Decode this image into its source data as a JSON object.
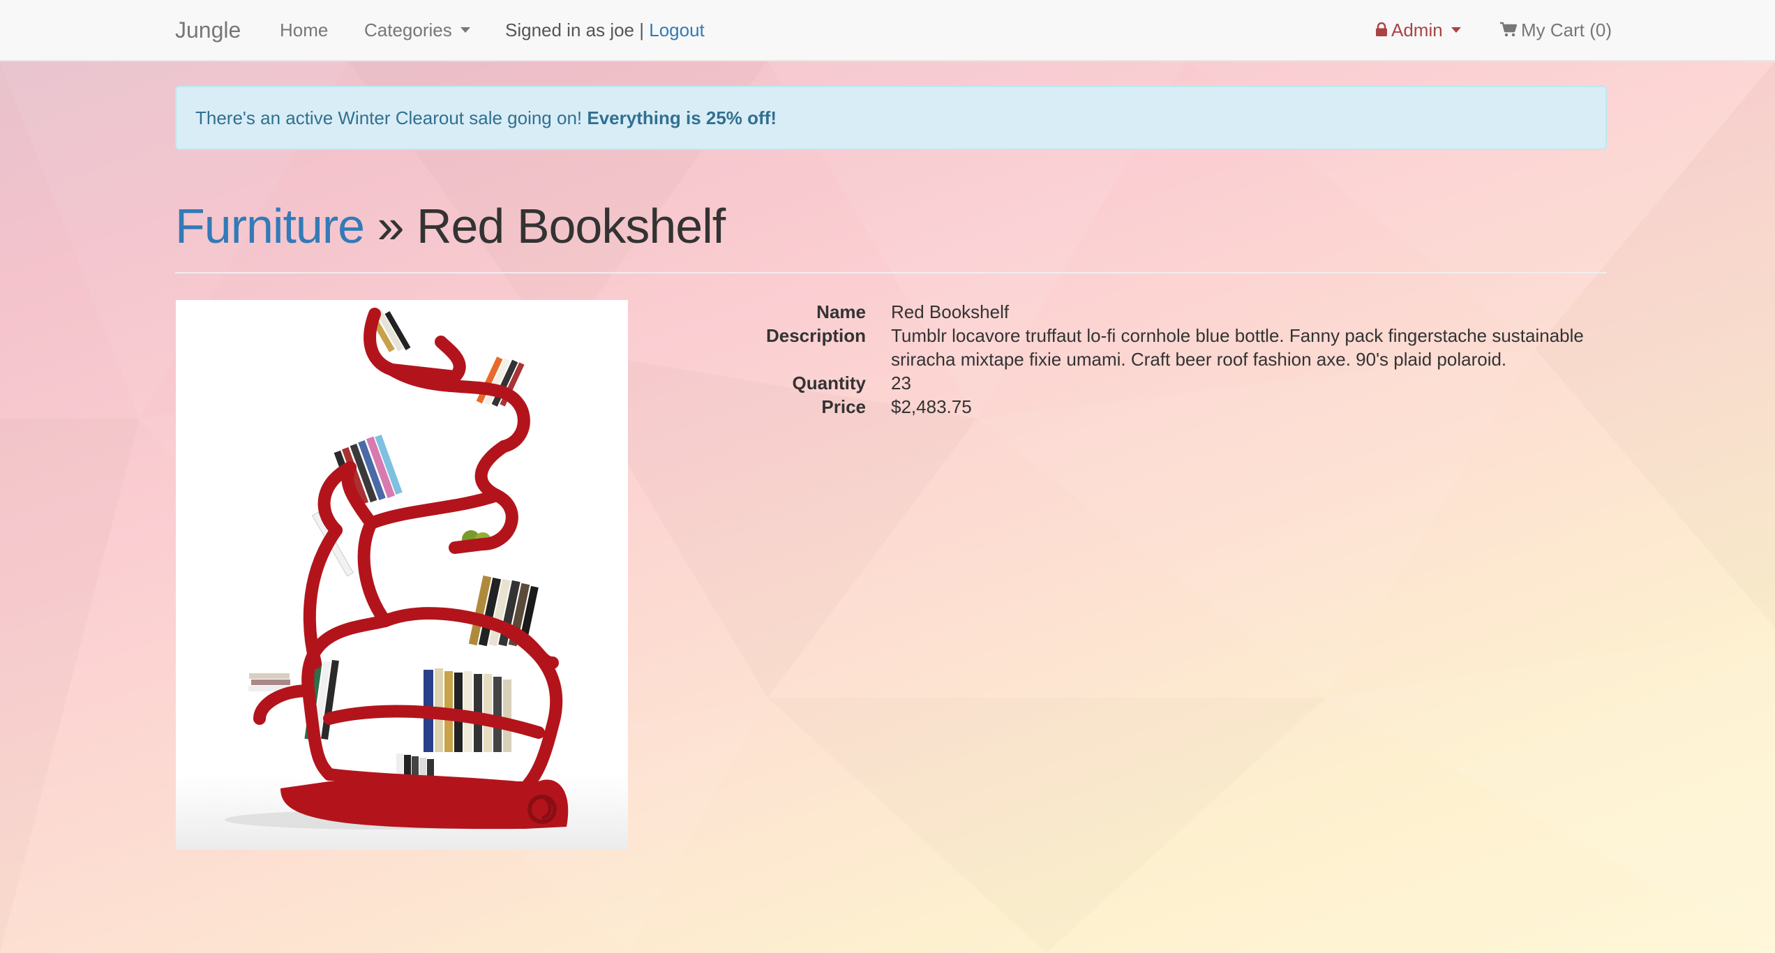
{
  "navbar": {
    "brand": "Jungle",
    "home": "Home",
    "categories": "Categories",
    "signed_in_text": "Signed in as joe |",
    "logout": "Logout",
    "admin": "Admin",
    "cart": "My Cart (0)"
  },
  "alert": {
    "text": "There's an active Winter Clearout sale going on!",
    "highlight": "Everything is 25% off!"
  },
  "header": {
    "category": "Furniture",
    "separator": "»",
    "product": "Red Bookshelf"
  },
  "product": {
    "image_alt": "Red Bookshelf",
    "fields": [
      {
        "label": "Name",
        "value": "Red Bookshelf"
      },
      {
        "label": "Description",
        "value": "Tumblr locavore truffaut lo-fi cornhole blue bottle. Fanny pack fingerstache sustainable sriracha mixtape fixie umami. Craft beer roof fashion axe. 90's plaid polaroid."
      },
      {
        "label": "Quantity",
        "value": "23"
      },
      {
        "label": "Price",
        "value": "$2,483.75"
      }
    ]
  },
  "colors": {
    "link": "#337ab7",
    "alert_bg": "#d9edf7",
    "alert_text": "#31708f",
    "admin": "#a94442",
    "shelf_red": "#b3141c"
  }
}
